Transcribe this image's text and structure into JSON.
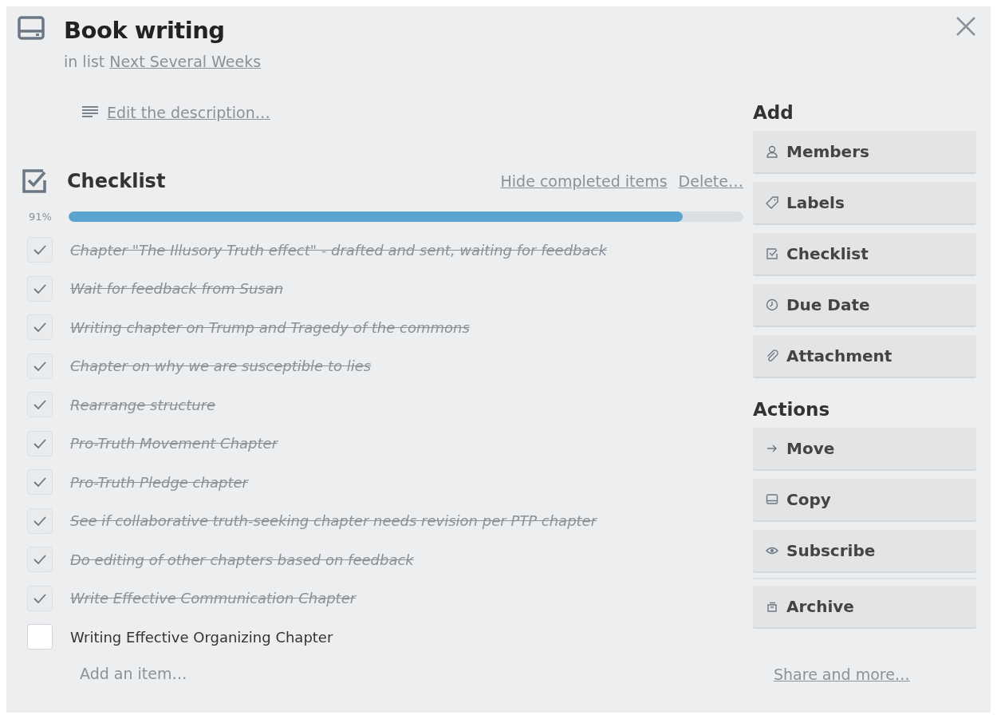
{
  "card": {
    "title": "Book writing",
    "list_prefix": "in list",
    "list_name": "Next Several Weeks"
  },
  "description": {
    "link": "Edit the description…"
  },
  "checklist": {
    "title": "Checklist",
    "hide_link": "Hide completed items",
    "delete_link": "Delete…",
    "percent": "91%",
    "level": 0.91,
    "items": [
      {
        "text": "Chapter \"The Illusory Truth effect\" - drafted and sent, waiting for feedback",
        "checked": true
      },
      {
        "text": "Wait for feedback from Susan",
        "checked": true
      },
      {
        "text": "Writing chapter on Trump and Tragedy of the commons",
        "checked": true
      },
      {
        "text": "Chapter on why we are susceptible to lies",
        "checked": true
      },
      {
        "text": "Rearrange structure",
        "checked": true
      },
      {
        "text": "Pro-Truth Movement Chapter",
        "checked": true
      },
      {
        "text": "Pro-Truth Pledge chapter",
        "checked": true
      },
      {
        "text": "See if collaborative truth-seeking chapter needs revision per PTP chapter",
        "checked": true
      },
      {
        "text": "Do editing of other chapters based on feedback",
        "checked": true
      },
      {
        "text": "Write Effective Communication Chapter",
        "checked": true
      },
      {
        "text": "Writing Effective Organizing Chapter",
        "checked": false
      }
    ],
    "add_item": "Add an item…"
  },
  "sidebar": {
    "add_title": "Add",
    "add_buttons": [
      {
        "label": "Members"
      },
      {
        "label": "Labels"
      },
      {
        "label": "Checklist"
      },
      {
        "label": "Due Date"
      },
      {
        "label": "Attachment"
      }
    ],
    "actions_title": "Actions",
    "action_buttons": [
      {
        "label": "Move",
        "divider_before": false
      },
      {
        "label": "Copy",
        "divider_before": false
      },
      {
        "label": "Subscribe",
        "divider_before": false
      },
      {
        "label": "Archive",
        "divider_before": true
      }
    ],
    "share_link": "Share and more…"
  }
}
